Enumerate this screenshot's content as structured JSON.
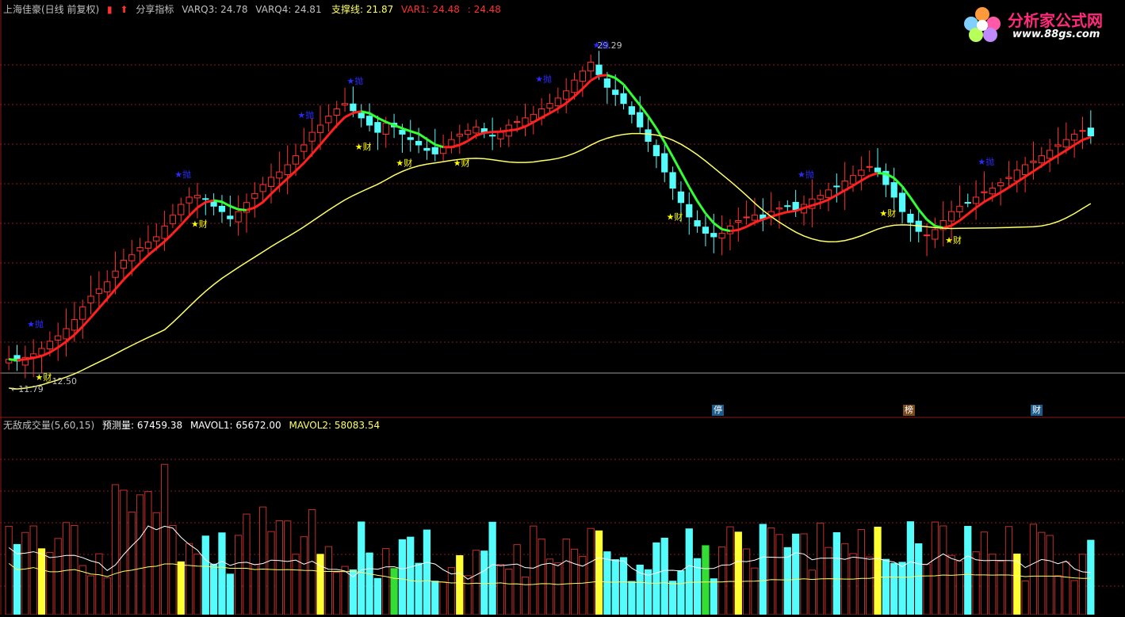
{
  "header": {
    "title": "上海佳豪(日线 前复权)",
    "indicator_name": "分享指标",
    "varq3": "VARQ3: 24.78",
    "varq4": "VARQ4: 24.81",
    "support": "支撑线: 21.87",
    "var1": "VAR1: 24.48",
    "var1b": ": 24.48"
  },
  "logo": {
    "title": "分析家公式网",
    "url": "www.88gs.com"
  },
  "volume_header": {
    "name": "无敌成交量(5,60,15)",
    "predict": "预测量: 67459.38",
    "mavol1": "MAVOL1: 65672.00",
    "mavol2": "MAVOL2: 58083.54"
  },
  "bottom_tags": [
    {
      "text": "停",
      "color": "#1c5c8c"
    },
    {
      "text": "榜",
      "color": "#7a4a1a"
    },
    {
      "text": "财",
      "color": "#1c5c8c"
    }
  ],
  "colors": {
    "up": "#ff3030",
    "down": "#54fcfc",
    "ma_red": "#ff2020",
    "ma_green": "#33ff33",
    "support_line": "#ffff66",
    "grid": "#8b1a1a",
    "signal_buy": "#2b2bff",
    "signal_star": "#ffff00"
  },
  "chart_data": {
    "type": "candlestick",
    "price_labels": {
      "high": "29.29",
      "low": "11.79",
      "low_line": "12.50"
    },
    "signal_texts": {
      "sell": "★抛",
      "buy": "★财"
    },
    "price_range": [
      10.8,
      30.5
    ],
    "closes": [
      12.4,
      12.3,
      12.5,
      12.7,
      13.0,
      13.4,
      13.7,
      14.1,
      14.6,
      15.3,
      15.9,
      16.3,
      16.7,
      17.3,
      17.9,
      18.2,
      18.6,
      18.9,
      19.2,
      19.8,
      20.4,
      21.0,
      21.4,
      21.5,
      21.3,
      20.9,
      20.6,
      20.2,
      20.6,
      21.1,
      21.6,
      22.1,
      22.5,
      22.8,
      23.2,
      23.7,
      24.3,
      25.0,
      25.4,
      25.9,
      26.3,
      26.6,
      26.2,
      25.8,
      25.4,
      25.0,
      25.5,
      25.3,
      24.9,
      24.6,
      24.3,
      24.0,
      23.8,
      24.2,
      24.6,
      24.9,
      25.1,
      25.3,
      25.0,
      24.8,
      25.0,
      25.4,
      25.6,
      25.8,
      26.0,
      26.3,
      26.6,
      26.9,
      27.3,
      27.9,
      28.4,
      28.9,
      28.2,
      27.5,
      27.1,
      26.6,
      26.0,
      25.3,
      24.5,
      23.7,
      22.8,
      21.9,
      21.1,
      20.3,
      19.8,
      19.4,
      19.2,
      19.4,
      19.8,
      20.1,
      20.3,
      20.4,
      20.2,
      20.6,
      20.8,
      20.9,
      20.7,
      21.0,
      21.3,
      21.5,
      21.8,
      22.0,
      22.3,
      22.6,
      22.9,
      23.1,
      22.8,
      22.1,
      21.4,
      20.6,
      20.0,
      19.5,
      19.3,
      19.6,
      20.1,
      20.6,
      20.9,
      21.1,
      21.4,
      21.7,
      21.9,
      22.2,
      22.5,
      22.9,
      23.2,
      23.4,
      23.7,
      24.0,
      24.3,
      24.6,
      24.9,
      25.1,
      24.8
    ]
  }
}
